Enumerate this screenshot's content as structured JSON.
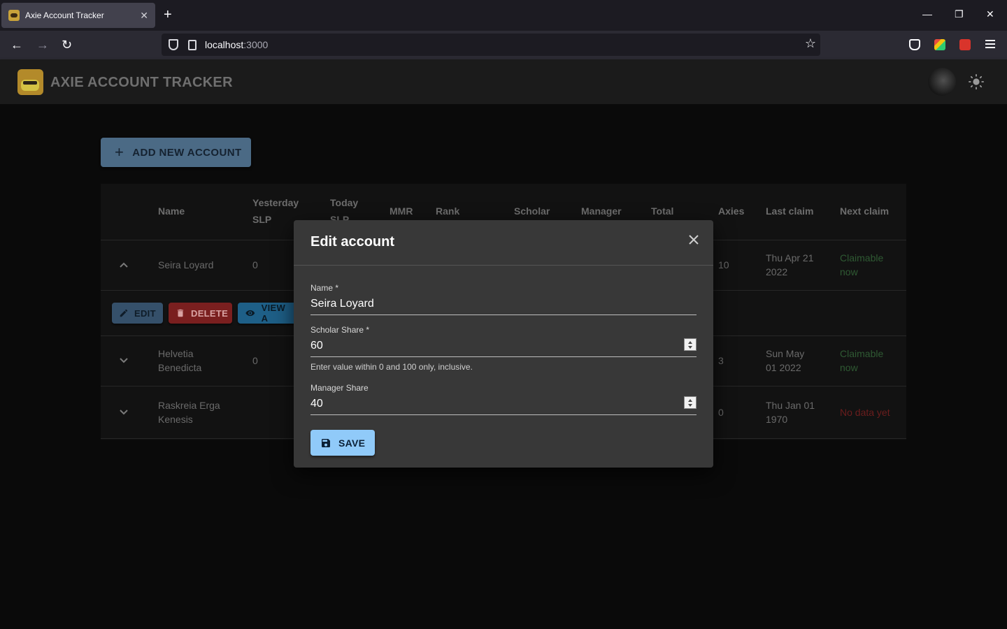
{
  "browser": {
    "tab_title": "Axie Account Tracker",
    "url_host": "localhost",
    "url_port": ":3000"
  },
  "app": {
    "title": "AXIE ACCOUNT TRACKER",
    "add_button": "ADD NEW ACCOUNT"
  },
  "table": {
    "headers": {
      "name": "Name",
      "yesterday_1": "Yesterday",
      "yesterday_2": "SLP",
      "today_1": "Today",
      "today_2": "SLP",
      "mmr": "MMR",
      "rank": "Rank",
      "scholar": "Scholar",
      "manager": "Manager",
      "total": "Total",
      "axies": "Axies",
      "last_claim": "Last claim",
      "next_claim": "Next claim"
    },
    "rows": [
      {
        "name_1": "Seira Loyard",
        "name_2": "",
        "yesterday": "0",
        "axies": "10",
        "last_1": "Thu Apr 21",
        "last_2": "2022",
        "next_1": "Claimable",
        "next_2": "now"
      },
      {
        "name_1": "Helvetia",
        "name_2": "Benedicta",
        "yesterday": "0",
        "axies": "3",
        "last_1": "Sun May",
        "last_2": "01 2022",
        "next_1": "Claimable",
        "next_2": "now"
      },
      {
        "name_1": "Raskreia Erga",
        "name_2": "Kenesis",
        "yesterday": "",
        "axies": "0",
        "last_1": "Thu Jan 01",
        "last_2": "1970",
        "next_1": "No data yet",
        "next_2": ""
      }
    ],
    "actions": {
      "edit": "EDIT",
      "delete": "DELETE",
      "view": "VIEW A"
    }
  },
  "dialog": {
    "title": "Edit account",
    "name_label": "Name *",
    "name_value": "Seira Loyard",
    "scholar_label": "Scholar Share *",
    "scholar_value": "60",
    "scholar_helper": "Enter value within 0 and 100 only, inclusive.",
    "manager_label": "Manager Share",
    "manager_value": "40",
    "save": "SAVE"
  }
}
